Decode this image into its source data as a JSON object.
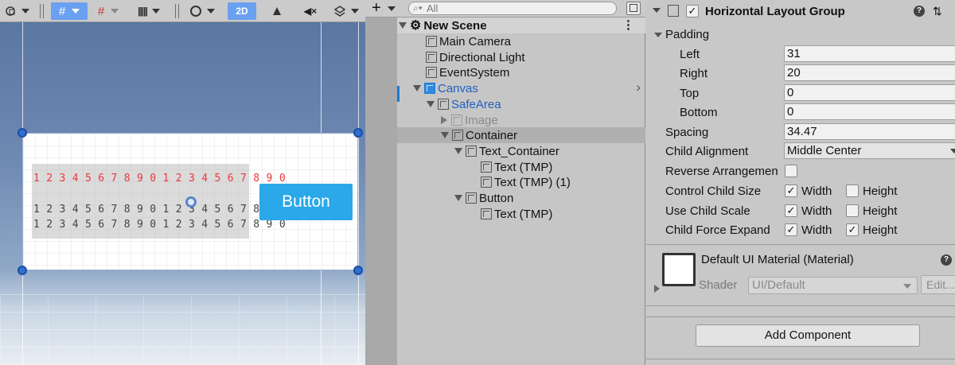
{
  "scene": {
    "toolbar": {
      "mode_2d_label": "2D"
    },
    "canvas_text": {
      "red_line": "1 2 3 4 5 6 7 8 9 0 1 2 3 4 5 6 7 8 9 0",
      "grey_line1": "1 2 3 4 5 6 7 8 9 0 1 2 3 4 5 6 7 8 9 0",
      "grey_line2": "1 2 3 4 5 6 7 8 9 0 1 2 3 4 5 6 7 8 9 0"
    },
    "button_label": "Button",
    "colors": {
      "red_text": "#e8383d",
      "button_bg": "#2aa8ea"
    }
  },
  "hierarchy": {
    "add_label": "+",
    "search_placeholder": "All",
    "items": [
      {
        "label": "New Scene"
      },
      {
        "label": "Main Camera"
      },
      {
        "label": "Directional Light"
      },
      {
        "label": "EventSystem"
      },
      {
        "label": "Canvas"
      },
      {
        "label": "SafeArea"
      },
      {
        "label": "Image"
      },
      {
        "label": "Container"
      },
      {
        "label": "Text_Container"
      },
      {
        "label": "Text (TMP)"
      },
      {
        "label": "Text (TMP) (1)"
      },
      {
        "label": "Button"
      },
      {
        "label": "Text (TMP)"
      }
    ],
    "colors": {
      "prefab_blue": "#1e60c0"
    }
  },
  "inspector": {
    "component_title": "Horizontal Layout Group",
    "padding_label": "Padding",
    "left_label": "Left",
    "left_value": "31",
    "right_label": "Right",
    "right_value": "20",
    "top_label": "Top",
    "top_value": "0",
    "bottom_label": "Bottom",
    "bottom_value": "0",
    "spacing_label": "Spacing",
    "spacing_value": "34.47",
    "child_alignment_label": "Child Alignment",
    "child_alignment_value": "Middle Center",
    "reverse_label": "Reverse Arrangemen",
    "control_size_label": "Control Child Size",
    "use_scale_label": "Use Child Scale",
    "force_expand_label": "Child Force Expand",
    "width_label": "Width",
    "height_label": "Height",
    "material_title": "Default UI Material (Material)",
    "shader_label": "Shader",
    "shader_value": "UI/Default",
    "edit_label": "Edit...",
    "add_component_label": "Add Component"
  }
}
